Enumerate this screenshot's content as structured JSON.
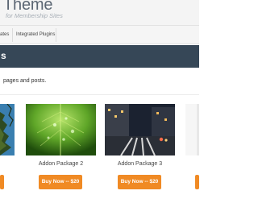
{
  "header": {
    "site_title": "Theme",
    "tagline": "for Membership Sites"
  },
  "nav": {
    "items": [
      {
        "label": "ates"
      },
      {
        "label": "Integrated Plugins"
      }
    ]
  },
  "banner": {
    "title": "s"
  },
  "intro": {
    "text": "pages and posts."
  },
  "products": [
    {
      "title": "",
      "button": "",
      "image": "tree-sky"
    },
    {
      "title": "Addon Package 2",
      "button": "Buy Now -- $20",
      "image": "green-leaf"
    },
    {
      "title": "Addon Package 3",
      "button": "Buy Now -- $20",
      "image": "city-night"
    },
    {
      "title": "",
      "button": "",
      "image": "partial"
    }
  ],
  "colors": {
    "banner": "#364757",
    "button": "#f08a24",
    "header_bg": "#f4f4f4"
  }
}
